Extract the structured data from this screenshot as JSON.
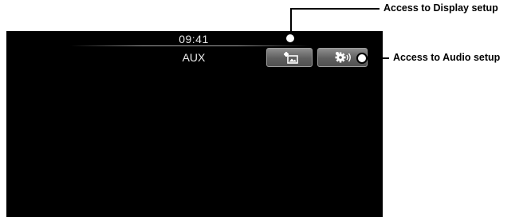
{
  "status_bar": {
    "time": "09:41",
    "source": "AUX"
  },
  "buttons": {
    "display_setup_icon": "display-setup-icon",
    "audio_setup_icon": "audio-setup-icon"
  },
  "callouts": {
    "display": "Access to Display setup",
    "audio": "Access to Audio setup"
  },
  "colors": {
    "screen_background": "#000000",
    "button_gradient_top": "#8d8d8d",
    "button_gradient_bottom": "#515151",
    "text": "#e8e8e8"
  }
}
